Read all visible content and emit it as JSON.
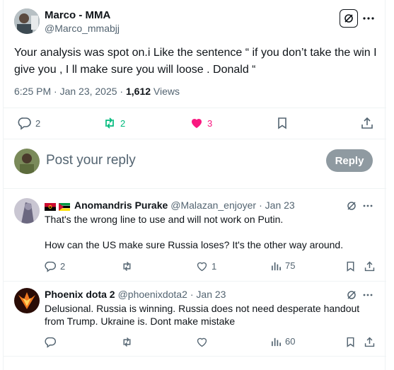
{
  "main_post": {
    "author_name": "Marco - MMA",
    "author_handle": "@Marco_mmabjj",
    "text_line1": "Your analysis was spot on.i Like the sentence “ if you don’t take the win I",
    "text_line2": "give you , I ll make sure you will loose . Donald “",
    "time": "6:25 PM · Jan 23, 2025 · ",
    "views_count": "1,612",
    "views_label": " Views",
    "replies": "2",
    "reposts": "2",
    "likes": "3"
  },
  "reply_composer": {
    "placeholder": "Post your reply",
    "button_label": "Reply"
  },
  "replies": [
    {
      "author_name": "Anomandris Purake",
      "author_handle": "@Malazan_enjoyer",
      "date": "· Jan 23",
      "text_line1": "That's the wrong line to use and will not work on Putin.",
      "text_line2": "How can the US make sure Russia loses? It's the other way around.",
      "replies": "2",
      "likes": "1",
      "views": "75"
    },
    {
      "author_name": "Phoenix dota 2",
      "author_handle": "@phoenixdota2",
      "date": "· Jan 23",
      "text_line1": "Delusional. Russia is winning. Russia does not need desperate handout",
      "text_line2": "from Trump. Ukraine is. Dont make mistake",
      "views": "60"
    }
  ],
  "colors": {
    "repost_green": "#00ba7c",
    "like_pink": "#f91880",
    "muted": "#536471",
    "reply_button": "#8f9aa1"
  }
}
